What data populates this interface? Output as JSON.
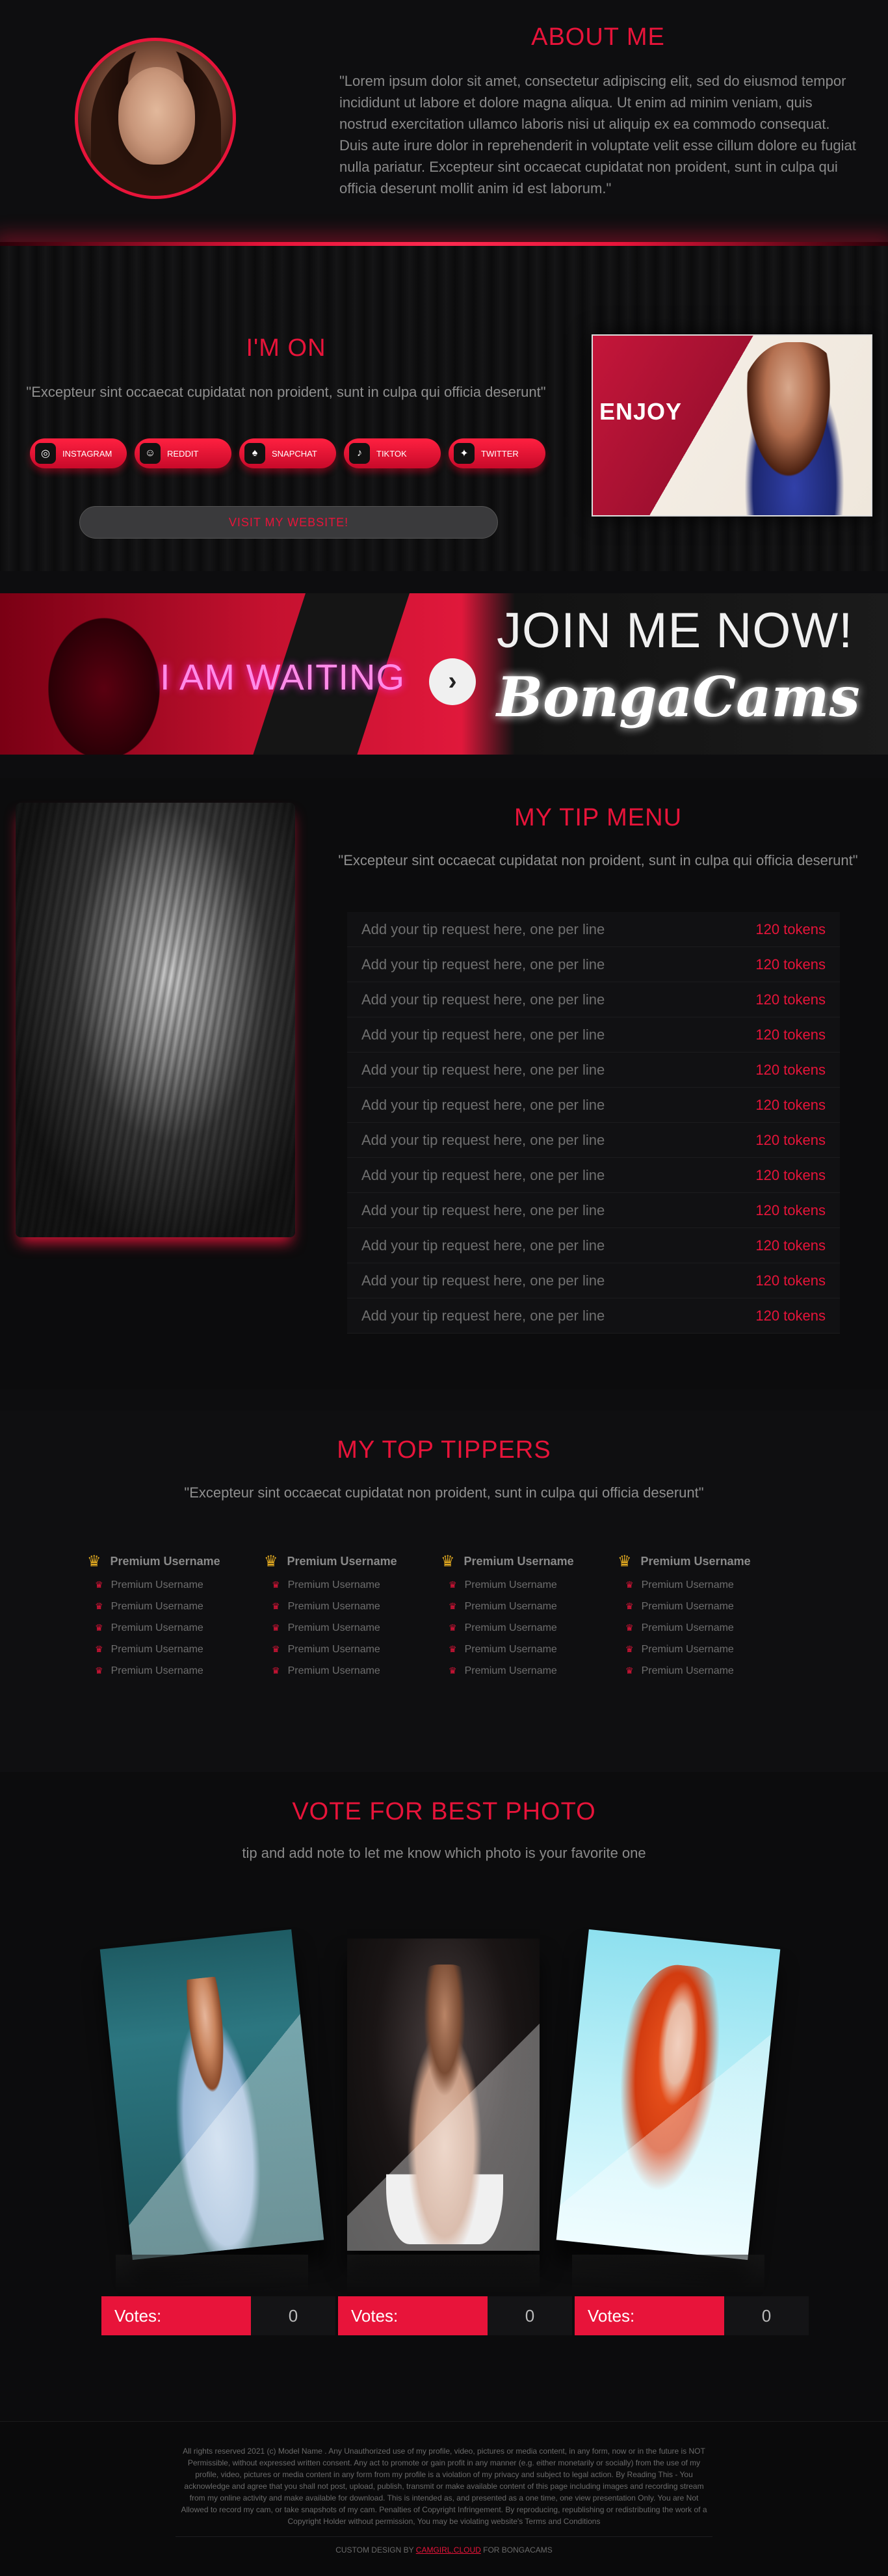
{
  "about": {
    "title": "ABOUT ME",
    "text": "\"Lorem ipsum dolor sit amet, consectetur adipiscing elit, sed do eiusmod tempor incididunt ut labore et dolore magna aliqua. Ut enim ad minim veniam, quis nostrud exercitation ullamco laboris nisi ut aliquip ex ea commodo consequat. Duis aute irure dolor in reprehenderit in voluptate velit esse cillum dolore eu fugiat nulla pariatur. Excepteur sint occaecat cupidatat non proident, sunt in culpa qui officia deserunt mollit anim id est laborum.\""
  },
  "imon": {
    "title": "I'M ON",
    "quote": "\"Excepteur sint occaecat cupidatat non proident, sunt in culpa qui officia deserunt\"",
    "socials": [
      {
        "label": "INSTAGRAM",
        "icon": "instagram-icon",
        "glyph": "◎"
      },
      {
        "label": "REDDIT",
        "icon": "reddit-icon",
        "glyph": "☺"
      },
      {
        "label": "SNAPCHAT",
        "icon": "snapchat-icon",
        "glyph": "♠"
      },
      {
        "label": "TIKTOK",
        "icon": "tiktok-icon",
        "glyph": "♪"
      },
      {
        "label": "TWITTER",
        "icon": "twitter-icon",
        "glyph": "✦"
      }
    ],
    "visit": "VISIT MY WEBSITE!",
    "enjoy": "ENJOY"
  },
  "banner": {
    "waiting": "I AM WAITING",
    "join": "JOIN ME NOW!",
    "brand": "BongaCams"
  },
  "tipmenu": {
    "title": "MY TIP MENU",
    "quote": "\"Excepteur sint occaecat cupidatat non proident, sunt in culpa qui officia deserunt\"",
    "items": [
      {
        "request": "Add your tip request here, one per line",
        "tokens": "120 tokens"
      },
      {
        "request": "Add your tip request here, one per line",
        "tokens": "120 tokens"
      },
      {
        "request": "Add your tip request here, one per line",
        "tokens": "120 tokens"
      },
      {
        "request": "Add your tip request here, one per line",
        "tokens": "120 tokens"
      },
      {
        "request": "Add your tip request here, one per line",
        "tokens": "120 tokens"
      },
      {
        "request": "Add your tip request here, one per line",
        "tokens": "120 tokens"
      },
      {
        "request": "Add your tip request here, one per line",
        "tokens": "120 tokens"
      },
      {
        "request": "Add your tip request here, one per line",
        "tokens": "120 tokens"
      },
      {
        "request": "Add your tip request here, one per line",
        "tokens": "120 tokens"
      },
      {
        "request": "Add your tip request here, one per line",
        "tokens": "120 tokens"
      },
      {
        "request": "Add your tip request here, one per line",
        "tokens": "120 tokens"
      },
      {
        "request": "Add your tip request here, one per line",
        "tokens": "120 tokens"
      }
    ]
  },
  "tippers": {
    "title": "MY TOP TIPPERS",
    "quote": "\"Excepteur sint occaecat cupidatat non proident, sunt in culpa qui officia deserunt\"",
    "columns": [
      {
        "top": "Premium Username",
        "others": [
          "Premium Username",
          "Premium Username",
          "Premium Username",
          "Premium Username",
          "Premium Username"
        ]
      },
      {
        "top": "Premium Username",
        "others": [
          "Premium Username",
          "Premium Username",
          "Premium Username",
          "Premium Username",
          "Premium Username"
        ]
      },
      {
        "top": "Premium Username",
        "others": [
          "Premium Username",
          "Premium Username",
          "Premium Username",
          "Premium Username",
          "Premium Username"
        ]
      },
      {
        "top": "Premium Username",
        "others": [
          "Premium Username",
          "Premium Username",
          "Premium Username",
          "Premium Username",
          "Premium Username"
        ]
      }
    ]
  },
  "vote": {
    "title": "VOTE FOR BEST PHOTO",
    "subtitle": "tip and add note to let me know which photo is your favorite one",
    "entries": [
      {
        "label": "Votes:",
        "count": "0"
      },
      {
        "label": "Votes:",
        "count": "0"
      },
      {
        "label": "Votes:",
        "count": "0"
      }
    ]
  },
  "footer": {
    "legal": "All rights reserved 2021 (c) Model Name . Any Unauthorized use of my profile, video, pictures or media content, in any form, now or in the future is NOT Permissible, without expressed written consent. Any act to promote or gain profit in any manner (e.g. either monetarily or socially) from the use of my profile, video, pictures or media content in any form from my profile is a violation of my privacy and subject to legal action. By Reading This - You acknowledge and agree that you shall not post, upload, publish, transmit or make available content of this page including images and recording stream from my online activity and make available for download. This is intended as, and presented as a one time, one view presentation Only. You are Not Allowed to record my cam, or take snapshots of my cam. Penalties of Copyright Infringement. By reproducing, republishing or redistributing the work of a Copyright Holder without permission, You may be violating website's Terms and Conditions",
    "credit_prefix": "CUSTOM DESIGN BY ",
    "credit_link": "CAMGIRL.CLOUD",
    "credit_suffix": " FOR BONGACAMS"
  }
}
